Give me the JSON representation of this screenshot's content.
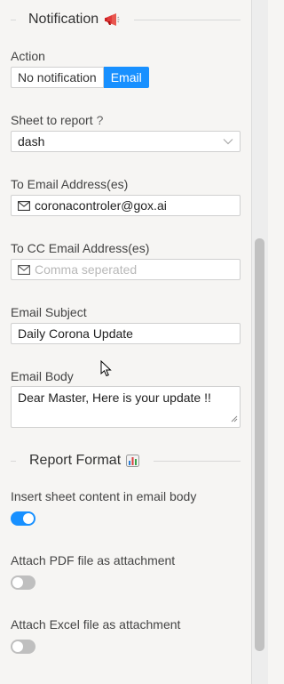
{
  "notification_section": {
    "title": "Notification",
    "icon": "megaphone-icon"
  },
  "action": {
    "label": "Action",
    "options": [
      "No notification",
      "Email"
    ],
    "selected": "Email"
  },
  "sheet": {
    "label": "Sheet to report",
    "help": "?",
    "value": "dash"
  },
  "to_email": {
    "label": "To Email Address(es)",
    "value": "coronacontroler@gox.ai"
  },
  "cc_email": {
    "label": "To CC Email Address(es)",
    "placeholder": "Comma seperated"
  },
  "subject": {
    "label": "Email Subject",
    "value": "Daily Corona Update"
  },
  "body": {
    "label": "Email Body",
    "value": "Dear Master, Here is your update !!"
  },
  "report_section": {
    "title": "Report Format",
    "icon": "bar-chart-icon"
  },
  "options": [
    {
      "label": "Insert sheet content in email body",
      "on": true
    },
    {
      "label": "Attach PDF file as attachment",
      "on": false
    },
    {
      "label": "Attach Excel file as attachment",
      "on": false
    }
  ],
  "colors": {
    "accent": "#1890ff",
    "toggle_off": "#bfbfbf",
    "background": "#f6f5f3"
  }
}
